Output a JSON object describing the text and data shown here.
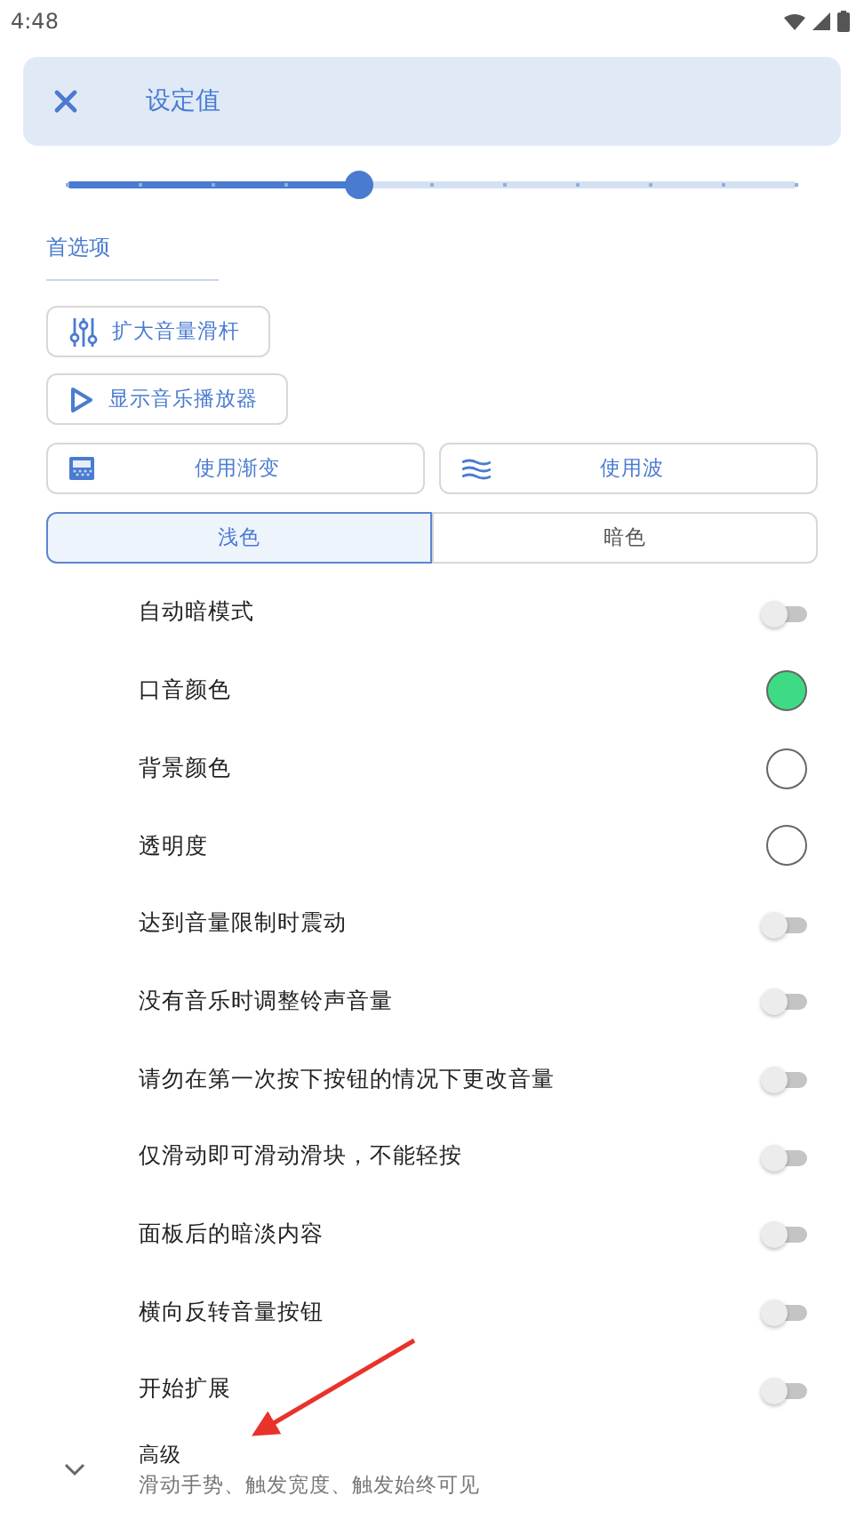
{
  "status_bar": {
    "time": "4:48"
  },
  "header": {
    "title": "设定值"
  },
  "slider": {
    "level": 0.4
  },
  "section": {
    "title": "首选项"
  },
  "buttons": [
    {
      "kind": "sliders",
      "label": "扩大音量滑杆"
    },
    {
      "kind": "play",
      "label": "显示音乐播放器"
    }
  ],
  "style_buttons": [
    {
      "kind": "gradient",
      "label": "使用渐变"
    },
    {
      "kind": "wave",
      "label": "使用波"
    }
  ],
  "theme_tabs": [
    {
      "label": "浅色",
      "selected": true
    },
    {
      "label": "暗色",
      "selected": false
    }
  ],
  "settings": [
    {
      "kind": "toggle",
      "label": "自动暗模式",
      "on": false
    },
    {
      "kind": "color",
      "label": "口音颜色",
      "color": "#3ddc84"
    },
    {
      "kind": "color",
      "label": "背景颜色",
      "color": "#ffffff"
    },
    {
      "kind": "color",
      "label": "透明度",
      "color": "#ffffff"
    },
    {
      "kind": "toggle",
      "label": "达到音量限制时震动",
      "on": false
    },
    {
      "kind": "toggle",
      "label": "没有音乐时调整铃声音量",
      "on": false
    },
    {
      "kind": "toggle",
      "label": "请勿在第一次按下按钮的情况下更改音量",
      "on": false
    },
    {
      "kind": "toggle",
      "label": "仅滑动即可滑动滑块，不能轻按",
      "on": false
    },
    {
      "kind": "toggle",
      "label": "面板后的暗淡内容",
      "on": false
    },
    {
      "kind": "toggle",
      "label": "横向反转音量按钮",
      "on": false
    },
    {
      "kind": "toggle",
      "label": "开始扩展",
      "on": false
    }
  ],
  "advanced": {
    "title": "高级",
    "summary": "滑动手势、触发宽度、触发始终可见",
    "expanded": false
  }
}
